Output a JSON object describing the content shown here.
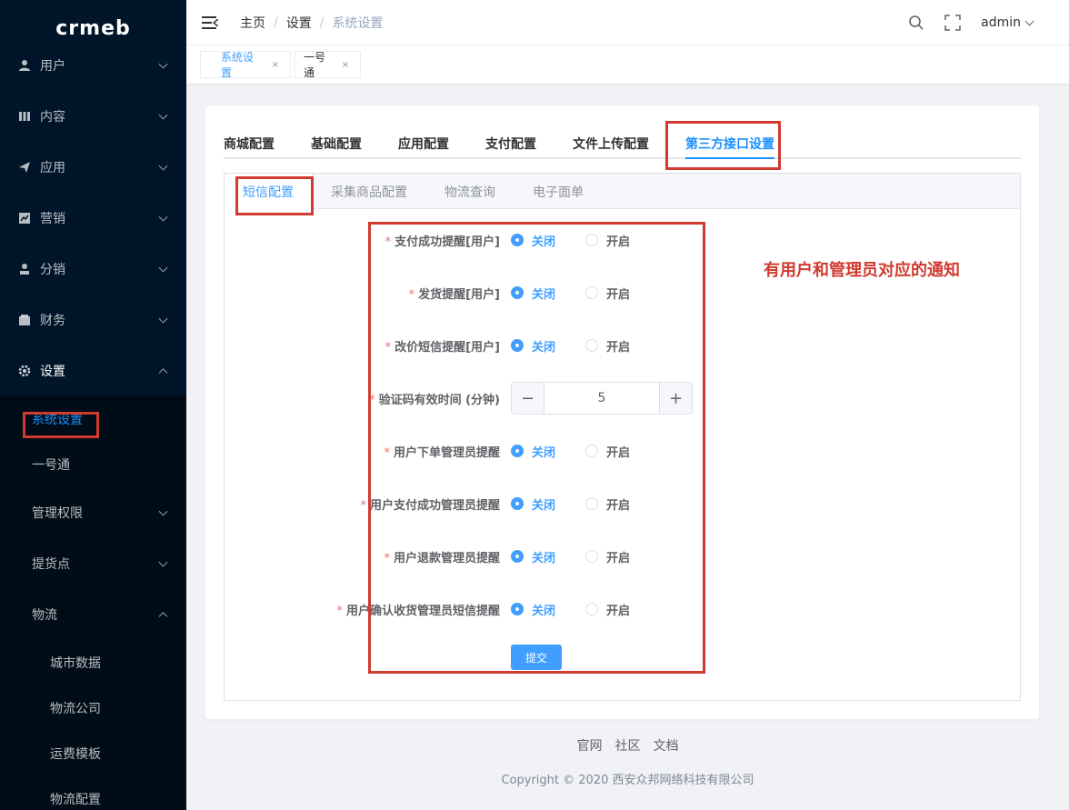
{
  "app": {
    "logo_text": "crmeb"
  },
  "sidebar": {
    "items": [
      {
        "label": "用户",
        "icon": "user-icon"
      },
      {
        "label": "内容",
        "icon": "content-icon"
      },
      {
        "label": "应用",
        "icon": "send-icon"
      },
      {
        "label": "营销",
        "icon": "chart-icon"
      },
      {
        "label": "分销",
        "icon": "distribution-icon"
      },
      {
        "label": "财务",
        "icon": "wallet-icon"
      },
      {
        "label": "设置",
        "icon": "gear-icon"
      }
    ],
    "sub_items": [
      {
        "label": "系统设置",
        "active": true
      },
      {
        "label": "一号通"
      },
      {
        "label": "管理权限"
      },
      {
        "label": "提货点"
      },
      {
        "label": "物流"
      }
    ],
    "logistics_items": [
      {
        "label": "城市数据"
      },
      {
        "label": "物流公司"
      },
      {
        "label": "运费模板"
      },
      {
        "label": "物流配置"
      }
    ]
  },
  "header": {
    "breadcrumb": [
      "主页",
      "设置",
      "系统设置"
    ],
    "user": "admin"
  },
  "tags": [
    {
      "label": "系统设置",
      "close": "×",
      "active": true
    },
    {
      "label": "一号通",
      "close": "×",
      "active": false
    }
  ],
  "tabs": [
    {
      "label": "商城配置"
    },
    {
      "label": "基础配置"
    },
    {
      "label": "应用配置"
    },
    {
      "label": "支付配置"
    },
    {
      "label": "文件上传配置"
    },
    {
      "label": "第三方接口设置",
      "active": true
    }
  ],
  "sub_tabs": [
    {
      "label": "短信配置",
      "active": true
    },
    {
      "label": "采集商品配置"
    },
    {
      "label": "物流查询"
    },
    {
      "label": "电子面单"
    }
  ],
  "form": {
    "required_mark": "*",
    "option_off": "关闭",
    "option_on": "开启",
    "rows": [
      {
        "label": "支付成功提醒[用户]",
        "value": "关闭"
      },
      {
        "label": "发货提醒[用户]",
        "value": "关闭"
      },
      {
        "label": "改价短信提醒[用户]",
        "value": "关闭"
      },
      {
        "label": "验证码有效时间 (分钟)",
        "number": "5"
      },
      {
        "label": "用户下单管理员提醒",
        "value": "关闭"
      },
      {
        "label": "用户支付成功管理员提醒",
        "value": "关闭"
      },
      {
        "label": "用户退款管理员提醒",
        "value": "关闭"
      },
      {
        "label": "用户确认收货管理员短信提醒",
        "value": "关闭"
      }
    ],
    "minus": "−",
    "plus": "+",
    "submit_label": "提交"
  },
  "annotation_text": "有用户和管理员对应的通知",
  "footer": {
    "links": [
      "官网",
      "社区",
      "文档"
    ],
    "copyright": "Copyright © 2020 西安众邦网络科技有限公司"
  },
  "colors": {
    "sidebar_bg": "#001529",
    "primary": "#409eff",
    "annotation_red": "#d03a2f"
  }
}
